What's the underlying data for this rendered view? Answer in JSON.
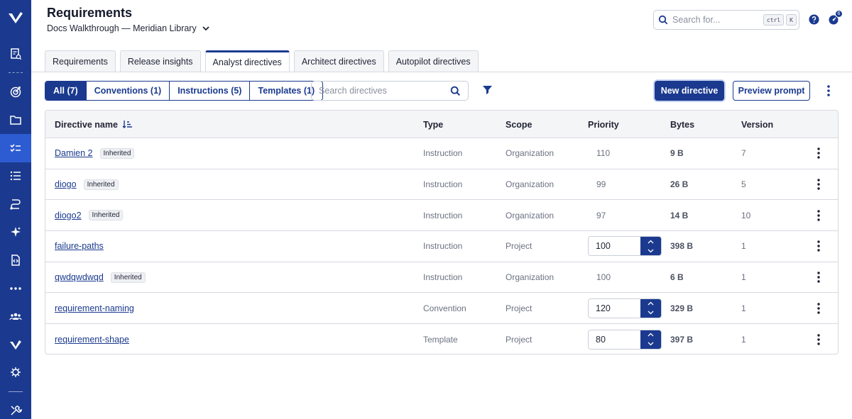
{
  "header": {
    "title": "Requirements",
    "project": "Docs Walkthrough — Meridian Library",
    "search_placeholder": "Search for...",
    "shortcut_keys": [
      "ctrl",
      "K"
    ],
    "notification_count": "6"
  },
  "tabs": [
    {
      "label": "Requirements",
      "active": false
    },
    {
      "label": "Release insights",
      "active": false
    },
    {
      "label": "Analyst directives",
      "active": true
    },
    {
      "label": "Architect directives",
      "active": false
    },
    {
      "label": "Autopilot directives",
      "active": false
    }
  ],
  "filters": {
    "segments": [
      "All (7)",
      "Conventions (1)",
      "Instructions (5)",
      "Templates (1)"
    ],
    "active_segment": "All (7)",
    "search_placeholder": "Search directives"
  },
  "actions": {
    "new_label": "New directive",
    "preview_label": "Preview prompt"
  },
  "table": {
    "columns": [
      "Directive name",
      "Type",
      "Scope",
      "Priority",
      "Bytes",
      "Version"
    ],
    "rows": [
      {
        "name": "Damien 2",
        "badge": "Inherited",
        "type": "Instruction",
        "scope": "Organization",
        "priority": "110",
        "editable": false,
        "bytes": "9 B",
        "version": "7"
      },
      {
        "name": "diogo",
        "badge": "Inherited",
        "type": "Instruction",
        "scope": "Organization",
        "priority": "99",
        "editable": false,
        "bytes": "26 B",
        "version": "5"
      },
      {
        "name": "diogo2",
        "badge": "Inherited",
        "type": "Instruction",
        "scope": "Organization",
        "priority": "97",
        "editable": false,
        "bytes": "14 B",
        "version": "10"
      },
      {
        "name": "failure-paths",
        "badge": "",
        "type": "Instruction",
        "scope": "Project",
        "priority": "100",
        "editable": true,
        "bytes": "398 B",
        "version": "1"
      },
      {
        "name": "qwdqwdwqd",
        "badge": "Inherited",
        "type": "Instruction",
        "scope": "Organization",
        "priority": "100",
        "editable": false,
        "bytes": "6 B",
        "version": "1"
      },
      {
        "name": "requirement-naming",
        "badge": "",
        "type": "Convention",
        "scope": "Project",
        "priority": "120",
        "editable": true,
        "bytes": "329 B",
        "version": "1"
      },
      {
        "name": "requirement-shape",
        "badge": "",
        "type": "Template",
        "scope": "Project",
        "priority": "80",
        "editable": true,
        "bytes": "397 B",
        "version": "1"
      }
    ]
  },
  "colors": {
    "brand": "#1b3a8f",
    "rail_active": "#2d5bd2"
  },
  "rail_icons": [
    "logo-icon",
    "requirements-doc-icon",
    "target-icon",
    "folder-icon",
    "checklist-icon",
    "list-icon",
    "flow-icon",
    "sparkle-icon",
    "file-code-icon",
    "more-icon",
    "team-icon",
    "brand-icon",
    "bug-icon",
    "tools-icon"
  ]
}
